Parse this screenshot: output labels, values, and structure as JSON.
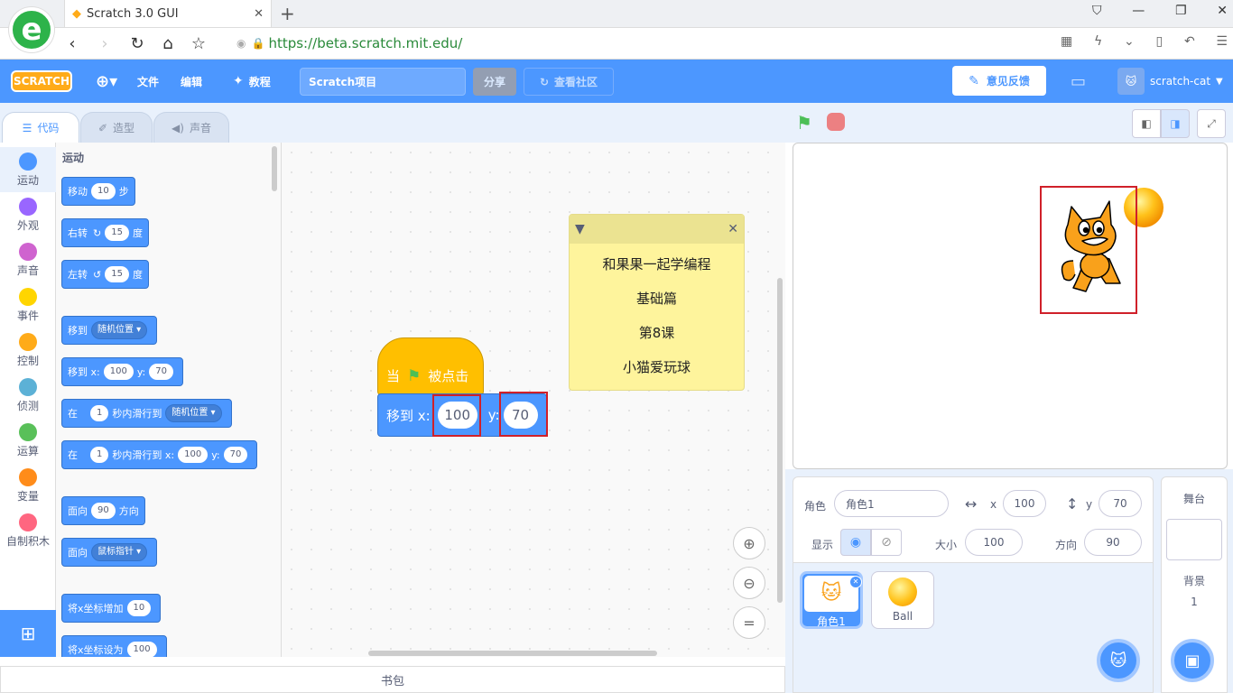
{
  "browser": {
    "tab_title": "Scratch 3.0 GUI",
    "url": "https://beta.scratch.mit.edu/",
    "new_tab_symbol": "+"
  },
  "menubar": {
    "logo": "SCRATCH",
    "file": "文件",
    "edit": "编辑",
    "tutorials": "教程",
    "project_title": "Scratch项目",
    "share": "分享",
    "see_community": "查看社区",
    "feedback": "意见反馈",
    "username": "scratch-cat"
  },
  "editor_tabs": [
    "代码",
    "造型",
    "声音"
  ],
  "categories": [
    {
      "label": "运动",
      "color": "#4c97ff"
    },
    {
      "label": "外观",
      "color": "#9966ff"
    },
    {
      "label": "声音",
      "color": "#cf63cf"
    },
    {
      "label": "事件",
      "color": "#ffd500"
    },
    {
      "label": "控制",
      "color": "#ffab19"
    },
    {
      "label": "侦测",
      "color": "#5cb1d6"
    },
    {
      "label": "运算",
      "color": "#59c059"
    },
    {
      "label": "变量",
      "color": "#ff8c1a"
    },
    {
      "label": "自制积木",
      "color": "#ff6680"
    }
  ],
  "palette": {
    "heading": "运动",
    "move": {
      "a": "移动",
      "v": "10",
      "b": "步"
    },
    "turn_right": {
      "a": "右转",
      "v": "15",
      "b": "度"
    },
    "turn_left": {
      "a": "左转",
      "v": "15",
      "b": "度"
    },
    "goto_menu": {
      "a": "移到",
      "menu": "随机位置"
    },
    "goto_xy": {
      "a": "移到 x:",
      "x": "100",
      "yl": "y:",
      "y": "70"
    },
    "glide_menu": {
      "a": "在",
      "v": "1",
      "b": "秒内滑行到",
      "menu": "随机位置"
    },
    "glide_xy": {
      "a": "在",
      "v": "1",
      "b": "秒内滑行到 x:",
      "x": "100",
      "yl": "y:",
      "y": "70"
    },
    "point_dir": {
      "a": "面向",
      "v": "90",
      "b": "方向"
    },
    "point_towards": {
      "a": "面向",
      "menu": "鼠标指针"
    },
    "change_x": {
      "a": "将x坐标增加",
      "v": "10"
    },
    "set_x": {
      "a": "将x坐标设为",
      "v": "100"
    }
  },
  "script": {
    "hat_a": "当",
    "hat_b": "被点击",
    "goto_label": "移到 x:",
    "x": "100",
    "y_label": "y:",
    "y": "70"
  },
  "note": {
    "lines": [
      "和果果一起学编程",
      "基础篇",
      "第8课",
      "小猫爱玩球"
    ],
    "close": "✕"
  },
  "backpack": "书包",
  "sprite_info": {
    "sprite_label": "角色",
    "sprite_name": "角色1",
    "x_label": "x",
    "x": "100",
    "y_label": "y",
    "y": "70",
    "show_label": "显示",
    "size_label": "大小",
    "size": "100",
    "direction_label": "方向",
    "direction": "90"
  },
  "sprites": [
    {
      "name": "角色1",
      "selected": true
    },
    {
      "name": "Ball",
      "selected": false
    }
  ],
  "stage_panel": {
    "title": "舞台",
    "backdrops_label": "背景",
    "backdrops_count": "1"
  },
  "colors": {
    "motion": "#4c97ff",
    "events": "#ffbf00",
    "menubar": "#4c97ff",
    "highlight": "#d0202a"
  }
}
